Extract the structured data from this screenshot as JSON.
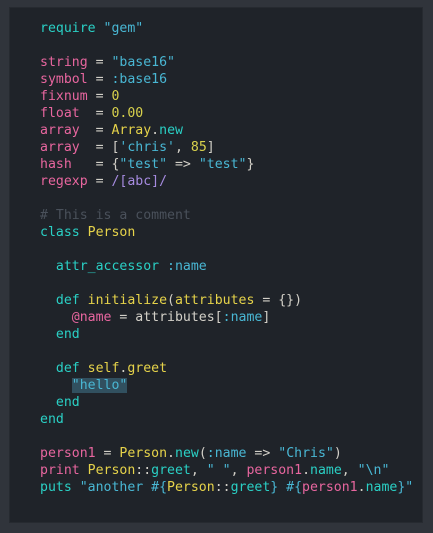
{
  "colors": {
    "background": "#1f2329",
    "keyword": "#2ad0c5",
    "string": "#49b7d4",
    "variable": "#e8669f",
    "number": "#d8d14c",
    "constant": "#e6d34a",
    "default": "#d3d0c8",
    "comment": "#4a515b",
    "selection": "#31505f"
  },
  "editor": {
    "lines": [
      [
        {
          "t": "require ",
          "c": "keyword"
        },
        {
          "t": "\"gem\"",
          "c": "string"
        }
      ],
      [],
      [
        {
          "t": "string",
          "c": "variable"
        },
        {
          "t": " = ",
          "c": "default"
        },
        {
          "t": "\"base16\"",
          "c": "string"
        }
      ],
      [
        {
          "t": "symbol",
          "c": "variable"
        },
        {
          "t": " = ",
          "c": "default"
        },
        {
          "t": ":base16",
          "c": "string"
        }
      ],
      [
        {
          "t": "fixnum",
          "c": "variable"
        },
        {
          "t": " = ",
          "c": "default"
        },
        {
          "t": "0",
          "c": "number"
        }
      ],
      [
        {
          "t": "float",
          "c": "variable"
        },
        {
          "t": "  = ",
          "c": "default"
        },
        {
          "t": "0.00",
          "c": "number"
        }
      ],
      [
        {
          "t": "array",
          "c": "variable"
        },
        {
          "t": "  = ",
          "c": "default"
        },
        {
          "t": "Array",
          "c": "constant"
        },
        {
          "t": ".",
          "c": "default"
        },
        {
          "t": "new",
          "c": "method"
        }
      ],
      [
        {
          "t": "array",
          "c": "variable"
        },
        {
          "t": "  = [",
          "c": "default"
        },
        {
          "t": "'chris'",
          "c": "string"
        },
        {
          "t": ", ",
          "c": "default"
        },
        {
          "t": "85",
          "c": "number"
        },
        {
          "t": "]",
          "c": "default"
        }
      ],
      [
        {
          "t": "hash",
          "c": "variable"
        },
        {
          "t": "   = {",
          "c": "default"
        },
        {
          "t": "\"test\"",
          "c": "string"
        },
        {
          "t": " => ",
          "c": "default"
        },
        {
          "t": "\"test\"",
          "c": "string"
        },
        {
          "t": "}",
          "c": "default"
        }
      ],
      [
        {
          "t": "regexp",
          "c": "variable"
        },
        {
          "t": " = ",
          "c": "default"
        },
        {
          "t": "/[abc]/",
          "c": "regex"
        }
      ],
      [],
      [
        {
          "t": "# This is a comment",
          "c": "comment"
        }
      ],
      [
        {
          "t": "class ",
          "c": "keyword"
        },
        {
          "t": "Person",
          "c": "constant"
        }
      ],
      [],
      [
        {
          "t": "  attr_accessor ",
          "c": "keyword"
        },
        {
          "t": ":name",
          "c": "string"
        }
      ],
      [],
      [
        {
          "t": "  def ",
          "c": "keyword"
        },
        {
          "t": "initialize",
          "c": "constant"
        },
        {
          "t": "(",
          "c": "default"
        },
        {
          "t": "attributes",
          "c": "constant"
        },
        {
          "t": " = {})",
          "c": "default"
        }
      ],
      [
        {
          "t": "    @name",
          "c": "ivar"
        },
        {
          "t": " = attributes[",
          "c": "default"
        },
        {
          "t": ":name",
          "c": "string"
        },
        {
          "t": "]",
          "c": "default"
        }
      ],
      [
        {
          "t": "  end",
          "c": "keyword"
        }
      ],
      [],
      [
        {
          "t": "  def ",
          "c": "keyword"
        },
        {
          "t": "self",
          "c": "constant"
        },
        {
          "t": ".",
          "c": "default"
        },
        {
          "t": "greet",
          "c": "constant"
        }
      ],
      [
        {
          "t": "    ",
          "c": "default"
        },
        {
          "t": "\"hello\"",
          "c": "string",
          "sel": true
        }
      ],
      [
        {
          "t": "  end",
          "c": "keyword"
        }
      ],
      [
        {
          "t": "end",
          "c": "keyword"
        }
      ],
      [],
      [
        {
          "t": "person1",
          "c": "variable"
        },
        {
          "t": " = ",
          "c": "default"
        },
        {
          "t": "Person",
          "c": "constant"
        },
        {
          "t": ".",
          "c": "default"
        },
        {
          "t": "new",
          "c": "method"
        },
        {
          "t": "(",
          "c": "default"
        },
        {
          "t": ":name",
          "c": "string"
        },
        {
          "t": " => ",
          "c": "default"
        },
        {
          "t": "\"Chris\"",
          "c": "string"
        },
        {
          "t": ")",
          "c": "default"
        }
      ],
      [
        {
          "t": "print ",
          "c": "variable"
        },
        {
          "t": "Person",
          "c": "constant"
        },
        {
          "t": "::",
          "c": "default"
        },
        {
          "t": "greet",
          "c": "method"
        },
        {
          "t": ", ",
          "c": "default"
        },
        {
          "t": "\" \"",
          "c": "string"
        },
        {
          "t": ", ",
          "c": "default"
        },
        {
          "t": "person1",
          "c": "variable"
        },
        {
          "t": ".",
          "c": "default"
        },
        {
          "t": "name",
          "c": "method"
        },
        {
          "t": ", ",
          "c": "default"
        },
        {
          "t": "\"\\n\"",
          "c": "string"
        }
      ],
      [
        {
          "t": "puts ",
          "c": "keyword"
        },
        {
          "t": "\"another #{",
          "c": "string"
        },
        {
          "t": "Person",
          "c": "constant"
        },
        {
          "t": "::",
          "c": "default"
        },
        {
          "t": "greet",
          "c": "method"
        },
        {
          "t": "} #{",
          "c": "string"
        },
        {
          "t": "person1",
          "c": "variable"
        },
        {
          "t": ".",
          "c": "default"
        },
        {
          "t": "name",
          "c": "method"
        },
        {
          "t": "}\"",
          "c": "string"
        }
      ]
    ]
  }
}
